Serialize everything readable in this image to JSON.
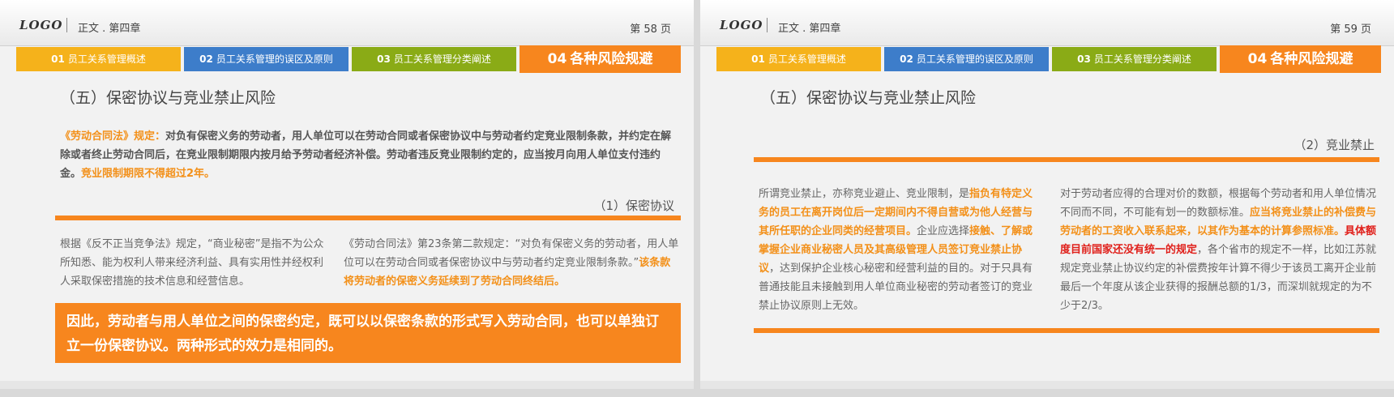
{
  "slides": [
    {
      "header": {
        "logo": "LOGO",
        "chapter": "正文 . 第四章",
        "page": "第 58 页"
      },
      "tabs": [
        {
          "num": "01",
          "label": "员工关系管理概述"
        },
        {
          "num": "02",
          "label": "员工关系管理的误区及原则"
        },
        {
          "num": "03",
          "label": "员工关系管理分类阐述"
        },
        {
          "num": "04",
          "label": "各种风险规避"
        }
      ],
      "section_title": "（五）保密协议与竞业禁止风险",
      "intro": {
        "lead": "《劳动合同法》规定：",
        "body": "对负有保密义务的劳动者，用人单位可以在劳动合同或者保密协议中与劳动者约定竞业限制条款，并约定在解除或者终止劳动合同后，在竞业限制期限内按月给予劳动者经济补偿。劳动者违反竞业限制约定的，应当按月向用人单位支付违约金。",
        "highlight": "竞业限制期限不得超过2年。"
      },
      "sub_label": "（1）保密协议",
      "col_left": "根据《反不正当竞争法》规定，“商业秘密”是指不为公众所知悉、能为权利人带来经济利益、具有实用性并经权利人采取保密措施的技术信息和经营信息。",
      "col_right": {
        "text": "《劳动合同法》第23条第二款规定：“对负有保密义务的劳动者，用人单位可以在劳动合同或者保密协议中与劳动者约定竞业限制条款。”",
        "highlight": "该条款将劳动者的保密义务延续到了劳动合同终结后。"
      },
      "banner": "因此，劳动者与用人单位之间的保密约定，既可以以保密条款的形式写入劳动合同，也可以单独订立一份保密协议。两种形式的效力是相同的。"
    },
    {
      "header": {
        "logo": "LOGO",
        "chapter": "正文 . 第四章",
        "page": "第 59 页"
      },
      "tabs": [
        {
          "num": "01",
          "label": "员工关系管理概述"
        },
        {
          "num": "02",
          "label": "员工关系管理的误区及原则"
        },
        {
          "num": "03",
          "label": "员工关系管理分类阐述"
        },
        {
          "num": "04",
          "label": "各种风险规避"
        }
      ],
      "section_title": "（五）保密协议与竞业禁止风险",
      "sub_label": "（2）竞业禁止",
      "col_left": {
        "p1": "所谓竞业禁止，亦称竞业避止、竞业限制，是",
        "h1": "指负有特定义务的员工在离开岗位后一定期间内不得自营或为他人经营与其所任职的企业同类的经营项目。",
        "p2": "企业应选择",
        "h2": "接触、了解或掌握企业商业秘密人员及其高级管理人员签订竞业禁止协议",
        "p3": "，达到保护企业核心秘密和经营利益的目的。对于只具有普通技能且未接触到用人单位商业秘密的劳动者签订的竞业禁止协议原则上无效。"
      },
      "col_right": {
        "p1": "对于劳动者应得的合理对价的数额，根据每个劳动者和用人单位情况不同而不同，不可能有划一的数额标准。",
        "h1": "应当将竞业禁止的补偿费与劳动者的工资收入联系起来，以其作为基本的计算参照标准。",
        "red": "具体额度目前国家还没有统一的规定",
        "p2": "，各个省市的规定不一样，比如江苏就规定竞业禁止协议约定的补偿费按年计算不得少于该员工离开企业前最后一个年度从该企业获得的报酬总额的1/3，而深圳就规定的为不少于2/3。"
      }
    }
  ]
}
